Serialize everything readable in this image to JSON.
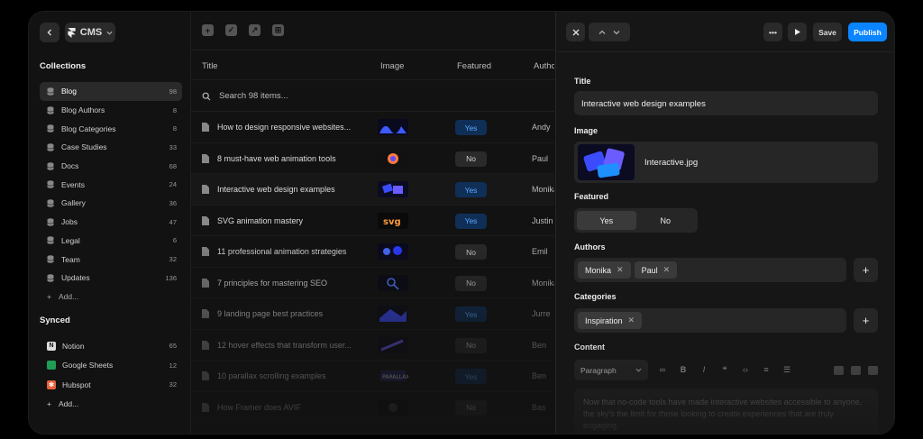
{
  "header": {
    "cms_label": "CMS"
  },
  "sidebar": {
    "collections_title": "Collections",
    "collections": [
      {
        "label": "Blog",
        "count": "98"
      },
      {
        "label": "Blog Authors",
        "count": "8"
      },
      {
        "label": "Blog Categories",
        "count": "8"
      },
      {
        "label": "Case Studies",
        "count": "33"
      },
      {
        "label": "Docs",
        "count": "68"
      },
      {
        "label": "Events",
        "count": "24"
      },
      {
        "label": "Gallery",
        "count": "36"
      },
      {
        "label": "Jobs",
        "count": "47"
      },
      {
        "label": "Legal",
        "count": "6"
      },
      {
        "label": "Team",
        "count": "32"
      },
      {
        "label": "Updates",
        "count": "136"
      }
    ],
    "add_label": "Add...",
    "synced_title": "Synced",
    "synced": [
      {
        "label": "Notion",
        "count": "65"
      },
      {
        "label": "Google Sheets",
        "count": "12"
      },
      {
        "label": "Hubspot",
        "count": "32"
      }
    ],
    "synced_add_label": "Add..."
  },
  "table": {
    "columns": {
      "title": "Title",
      "image": "Image",
      "featured": "Featured",
      "author": "Author"
    },
    "search_placeholder": "Search 98 items...",
    "rows": [
      {
        "title": "How to design responsive websites...",
        "featured": "Yes",
        "author": "Andy"
      },
      {
        "title": "8 must-have web animation tools",
        "featured": "No",
        "author": "Paul"
      },
      {
        "title": "Interactive web design examples",
        "featured": "Yes",
        "author": "Monika"
      },
      {
        "title": "SVG animation mastery",
        "featured": "Yes",
        "author": "Justin"
      },
      {
        "title": "11 professional animation strategies",
        "featured": "No",
        "author": "Emil"
      },
      {
        "title": "7 principles for mastering SEO",
        "featured": "No",
        "author": "Monika"
      },
      {
        "title": "9 landing page best practices",
        "featured": "Yes",
        "author": "Jurre"
      },
      {
        "title": "12 hover effects that transform user...",
        "featured": "No",
        "author": "Ben"
      },
      {
        "title": "10 parallax scrolling examples",
        "featured": "Yes",
        "author": "Ben"
      },
      {
        "title": "How Framer does AVIF",
        "featured": "No",
        "author": "Bas"
      }
    ]
  },
  "panel": {
    "save_label": "Save",
    "publish_label": "Publish",
    "title_label": "Title",
    "title_value": "Interactive web design examples",
    "image_label": "Image",
    "image_name": "Interactive.jpg",
    "featured_label": "Featured",
    "featured_yes": "Yes",
    "featured_no": "No",
    "authors_label": "Authors",
    "authors": [
      "Monika",
      "Paul"
    ],
    "categories_label": "Categories",
    "categories": [
      "Inspiration"
    ],
    "content_label": "Content",
    "paragraph_label": "Paragraph",
    "content_text": "Now that no-code tools have made interactive websites accessible to anyone, the sky's the limit for those looking to create experiences that are truly engaging."
  },
  "colors": {
    "accent": "#0a84ff",
    "yes_bg": "#0f2f57",
    "yes_text": "#5aa8ff"
  }
}
